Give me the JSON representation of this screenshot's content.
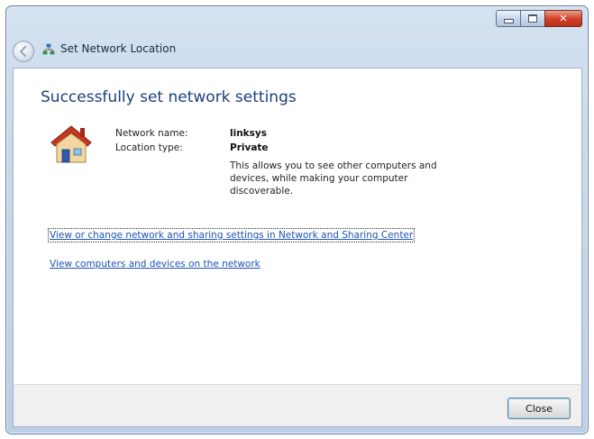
{
  "window": {
    "title": "Set Network Location",
    "caption": {
      "minimize": "–",
      "maximize": "□",
      "close": "✕"
    }
  },
  "content": {
    "heading": "Successfully set network settings",
    "network_name_label": "Network name:",
    "network_name_value": "linksys",
    "location_type_label": "Location type:",
    "location_type_value": "Private",
    "description": "This allows you to see other computers and devices, while making your computer discoverable.",
    "links": {
      "network_sharing_center": "View or change network and sharing settings in Network and Sharing Center",
      "view_computers": "View computers and devices on the network"
    }
  },
  "footer": {
    "close_label": "Close"
  },
  "icons": {
    "back": "back-arrow-icon",
    "network": "network-icon",
    "location": "house-icon"
  },
  "colors": {
    "heading": "#1c3f7c",
    "link": "#1a53b5",
    "frame": "#c7d8ec",
    "close_button_accent": "#d2432a"
  }
}
